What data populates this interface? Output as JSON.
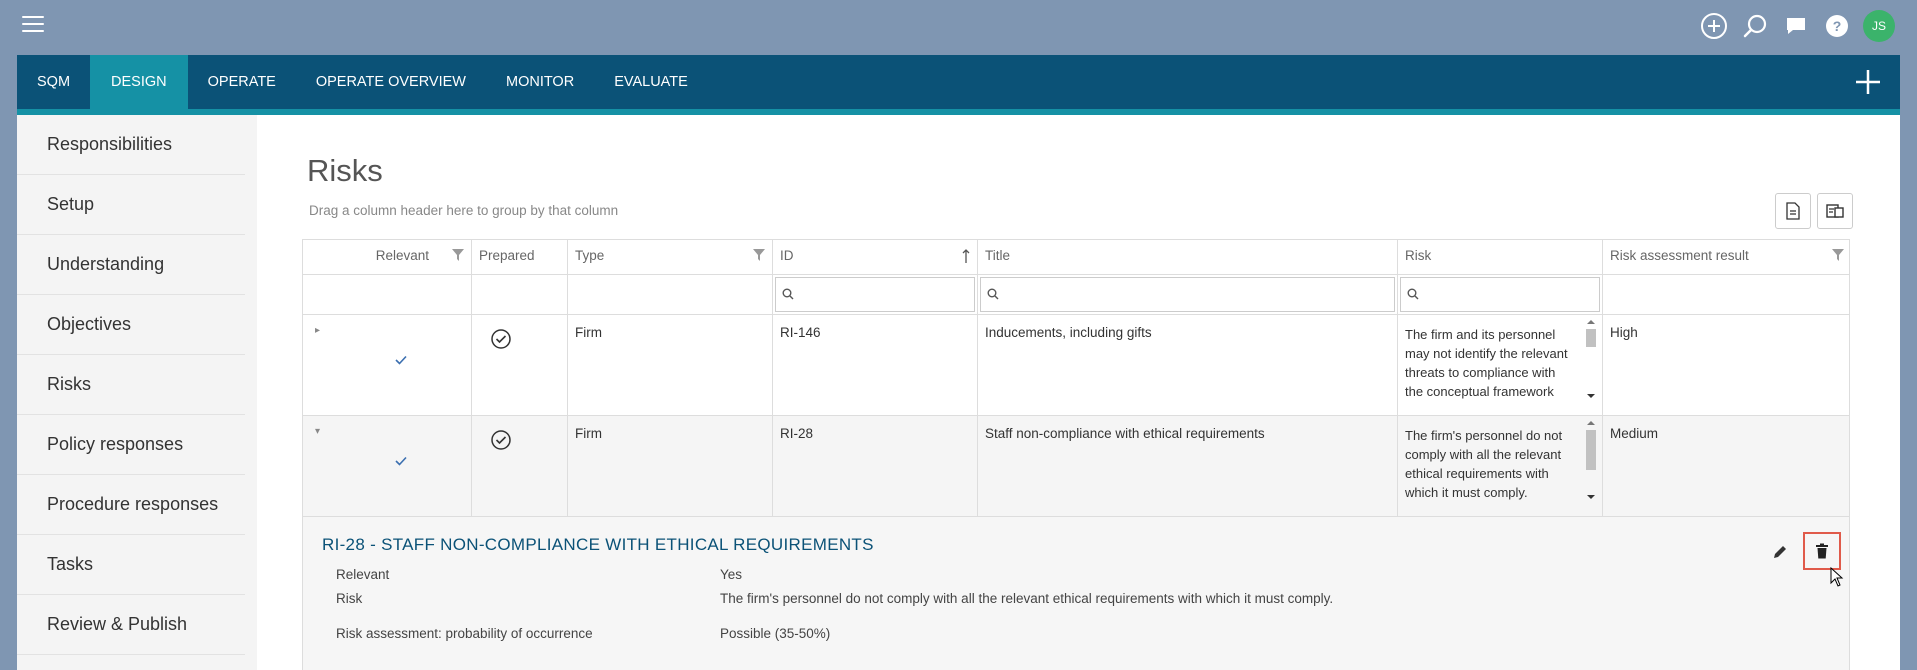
{
  "topbar": {
    "avatar_initials": "JS",
    "icons": [
      "add-circle-icon",
      "search-icon",
      "chat-icon",
      "help-icon"
    ]
  },
  "nav": {
    "tabs": [
      {
        "label": "SQM",
        "active": false
      },
      {
        "label": "DESIGN",
        "active": true
      },
      {
        "label": "OPERATE",
        "active": false
      },
      {
        "label": "OPERATE OVERVIEW",
        "active": false
      },
      {
        "label": "MONITOR",
        "active": false
      },
      {
        "label": "EVALUATE",
        "active": false
      }
    ],
    "accent_color": "#1591a5",
    "bar_color": "#0b5277"
  },
  "sidebar": {
    "items": [
      {
        "label": "Responsibilities"
      },
      {
        "label": "Setup"
      },
      {
        "label": "Understanding"
      },
      {
        "label": "Objectives"
      },
      {
        "label": "Risks"
      },
      {
        "label": "Policy responses"
      },
      {
        "label": "Procedure responses"
      },
      {
        "label": "Tasks"
      },
      {
        "label": "Review & Publish"
      }
    ]
  },
  "main": {
    "title": "Risks",
    "group_hint": "Drag a column header here to group by that column"
  },
  "grid": {
    "columns": [
      {
        "label": "Relevant",
        "filter": true
      },
      {
        "label": "Prepared",
        "filter": false
      },
      {
        "label": "Type",
        "filter": true
      },
      {
        "label": "ID",
        "sort": "ascending"
      },
      {
        "label": "Title",
        "filter": false
      },
      {
        "label": "Risk",
        "filter": false
      },
      {
        "label": "Risk assessment result",
        "filter": true
      }
    ],
    "rows": [
      {
        "expanded": false,
        "relevant": true,
        "prepared": true,
        "type": "Firm",
        "id": "RI-146",
        "title": "Inducements, including gifts",
        "risk": "The firm and its personnel may not identify the relevant threats to compliance with the conceptual framework",
        "result": "High"
      },
      {
        "expanded": true,
        "relevant": true,
        "prepared": true,
        "type": "Firm",
        "id": "RI-28",
        "title": "Staff non-compliance with ethical requirements",
        "risk": "The firm's personnel do not comply with all the relevant ethical requirements with which it must comply.",
        "result": "Medium"
      }
    ]
  },
  "detail": {
    "title": "RI-28 - STAFF NON-COMPLIANCE WITH ETHICAL REQUIREMENTS",
    "fields": [
      {
        "label": "Relevant",
        "value": "Yes"
      },
      {
        "label": "Risk",
        "value": "The firm's personnel do not comply with all the relevant ethical requirements with which it must comply."
      },
      {
        "label": "Risk assessment: probability of occurrence",
        "value": "Possible (35-50%)"
      }
    ],
    "highlight_color": "#e05a4a"
  }
}
